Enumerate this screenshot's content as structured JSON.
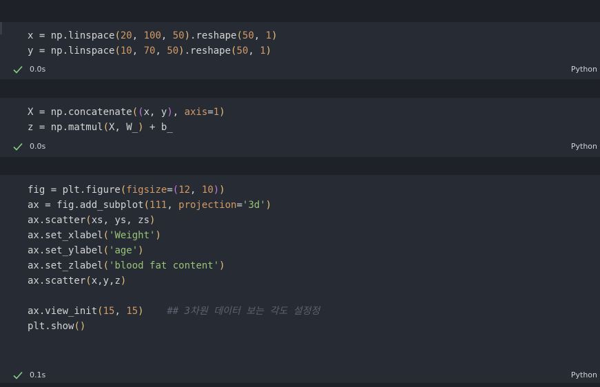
{
  "colors": {
    "background": "#1e2127",
    "cell": "#272b33",
    "number": "#d19a66",
    "string": "#98c379",
    "bracket": "#e5c07b",
    "bracket_nested": "#c678dd",
    "comment": "#5c6370",
    "check": "#89d185"
  },
  "cells": [
    {
      "lines": [
        "x = np.linspace(20, 100, 50).reshape(50, 1)",
        "y = np.linspace(10, 70, 50).reshape(50, 1)"
      ],
      "status": {
        "time": "0.0s",
        "language": "Python",
        "icon": "check-icon"
      }
    },
    {
      "lines": [
        "X = np.concatenate((x, y), axis=1)",
        "z = np.matmul(X, W_) + b_"
      ],
      "status": {
        "time": "0.0s",
        "language": "Python",
        "icon": "check-icon"
      }
    },
    {
      "lines": [
        "fig = plt.figure(figsize=(12, 10))",
        "ax = fig.add_subplot(111, projection='3d')",
        "ax.scatter(xs, ys, zs)",
        "ax.set_xlabel('Weight')",
        "ax.set_ylabel('age')",
        "ax.set_zlabel('blood fat content')",
        "ax.scatter(x,y,z)",
        "",
        "ax.view_init(15, 15)    ## 3차원 데이터 보는 각도 설정정",
        "plt.show()"
      ],
      "status": {
        "time": "0.1s",
        "language": "Python",
        "icon": "check-icon"
      }
    }
  ]
}
